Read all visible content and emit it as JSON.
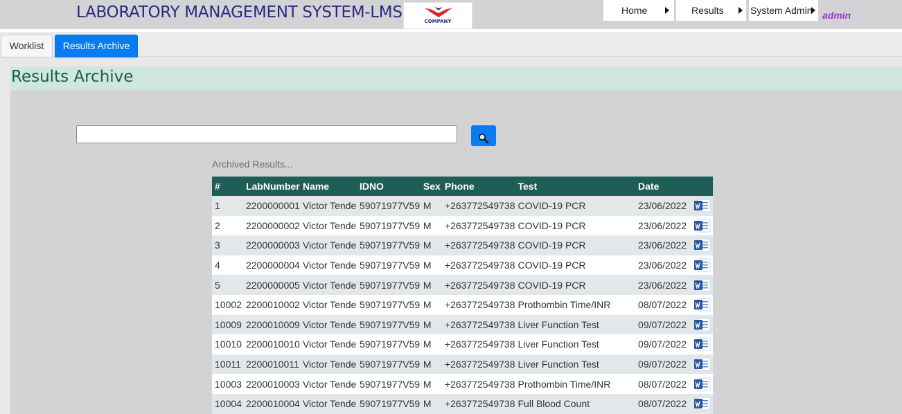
{
  "header": {
    "app_title": "LABORATORY MANAGEMENT SYSTEM-LMS",
    "logo_text": "COMPANY",
    "nav": [
      {
        "label": "Home"
      },
      {
        "label": "Results"
      },
      {
        "label": "System Admin"
      }
    ],
    "user": "admin"
  },
  "tabs": [
    {
      "label": "Worklist",
      "active": false
    },
    {
      "label": "Results Archive",
      "active": true
    }
  ],
  "page": {
    "title": "Results Archive",
    "search": {
      "value": "",
      "placeholder": ""
    },
    "caption": "Archived Results..."
  },
  "table": {
    "columns": [
      "#",
      "LabNumber",
      "Name",
      "IDNO",
      "Sex",
      "Phone",
      "Test",
      "Date",
      ""
    ],
    "rows": [
      [
        "1",
        "2200000001",
        "Victor Tende",
        "59071977V59",
        "M",
        "+263772549738",
        "COVID-19 PCR",
        "23/06/2022"
      ],
      [
        "2",
        "2200000002",
        "Victor Tende",
        "59071977V59",
        "M",
        "+263772549738",
        "COVID-19 PCR",
        "23/06/2022"
      ],
      [
        "3",
        "2200000003",
        "Victor Tende",
        "59071977V59",
        "M",
        "+263772549738",
        "COVID-19 PCR",
        "23/06/2022"
      ],
      [
        "4",
        "2200000004",
        "Victor Tende",
        "59071977V59",
        "M",
        "+263772549738",
        "COVID-19 PCR",
        "23/06/2022"
      ],
      [
        "5",
        "2200000005",
        "Victor Tende",
        "59071977V59",
        "M",
        "+263772549738",
        "COVID-19 PCR",
        "23/06/2022"
      ],
      [
        "10002",
        "2200010002",
        "Victor Tende",
        "59071977V59",
        "M",
        "+263772549738",
        "Prothombin Time/INR",
        "08/07/2022"
      ],
      [
        "10009",
        "2200010009",
        "Victor Tende",
        "59071977V59",
        "M",
        "+263772549738",
        "Liver Function Test",
        "09/07/2022"
      ],
      [
        "10010",
        "2200010010",
        "Victor Tende",
        "59071977V59",
        "M",
        "+263772549738",
        "Liver Function Test",
        "09/07/2022"
      ],
      [
        "10011",
        "2200010011",
        "Victor Tende",
        "59071977V59",
        "M",
        "+263772549738",
        "Liver Function Test",
        "09/07/2022"
      ],
      [
        "10003",
        "2200010003",
        "Victor Tende",
        "59071977V59",
        "M",
        "+263772549738",
        "Prothombin Time/INR",
        "08/07/2022"
      ],
      [
        "10004",
        "2200010004",
        "Victor Tende",
        "59071977V59",
        "M",
        "+263772549738",
        "Full Blood Count",
        "08/07/2022"
      ]
    ],
    "row_action_icon": "word-document-icon"
  },
  "colors": {
    "title_navy": "#2b2a82",
    "accent_blue": "#0a7cf3",
    "table_header": "#1e5e56",
    "page_title": "#1e5a4e",
    "user_purple": "#9933cc"
  }
}
